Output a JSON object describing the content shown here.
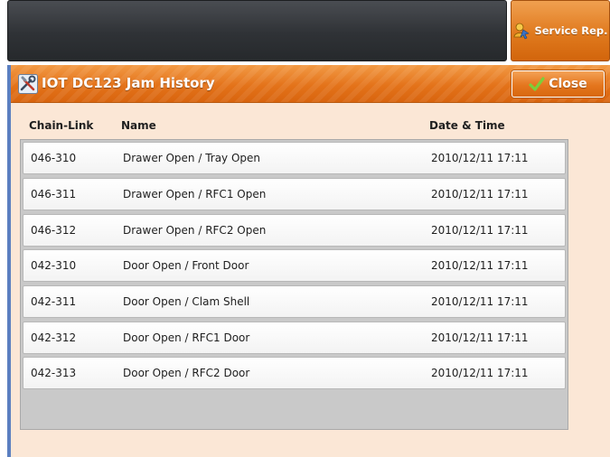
{
  "header": {
    "service_button_label": "Service Rep."
  },
  "dialog": {
    "title": "IOT DC123 Jam History",
    "close_label": "Close",
    "columns": {
      "chain_link": "Chain-Link",
      "name": "Name",
      "date_time": "Date & Time"
    },
    "rows": [
      {
        "chain_link": "046-310",
        "name": "Drawer Open / Tray Open",
        "date_time": "2010/12/11 17:11"
      },
      {
        "chain_link": "046-311",
        "name": "Drawer Open / RFC1 Open",
        "date_time": "2010/12/11 17:11"
      },
      {
        "chain_link": "046-312",
        "name": "Drawer Open / RFC2 Open",
        "date_time": "2010/12/11 17:11"
      },
      {
        "chain_link": "042-310",
        "name": "Door Open / Front Door",
        "date_time": "2010/12/11 17:11"
      },
      {
        "chain_link": "042-311",
        "name": "Door Open / Clam Shell",
        "date_time": "2010/12/11 17:11"
      },
      {
        "chain_link": "042-312",
        "name": "Door Open / RFC1 Door",
        "date_time": "2010/12/11 17:11"
      },
      {
        "chain_link": "042-313",
        "name": "Door Open / RFC2 Door",
        "date_time": "2010/12/11 17:11"
      }
    ]
  },
  "icons": {
    "service": "service-rep-icon",
    "title": "tools-icon",
    "close": "checkmark-icon"
  },
  "colors": {
    "accent_orange": "#e4731a",
    "dialog_background": "#fbe7d6",
    "topbar_dark": "#2f3236",
    "window_border_blue": "#5b7fc0"
  }
}
